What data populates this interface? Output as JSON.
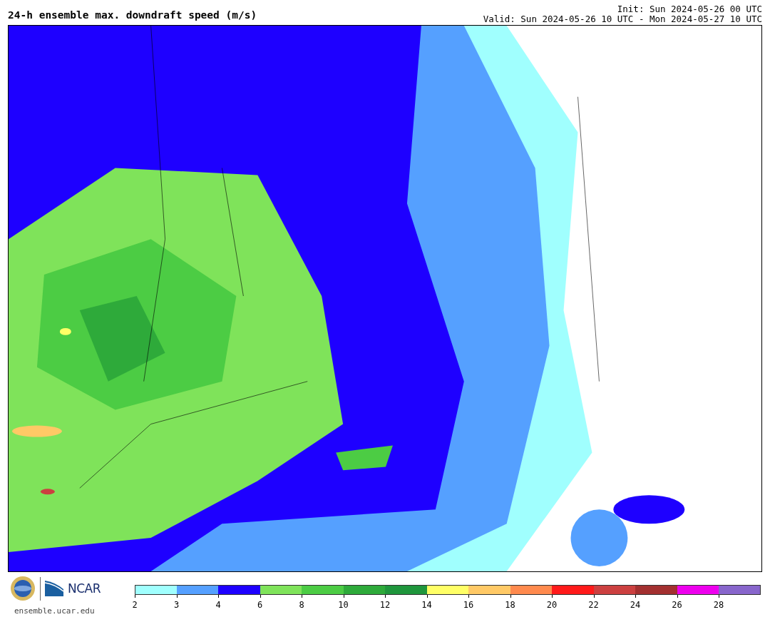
{
  "title": "24-h ensemble max. downdraft speed (m/s)",
  "init": "Init: Sun 2024-05-26 00 UTC",
  "valid": "Valid: Sun 2024-05-26 10 UTC - Mon 2024-05-27 10 UTC",
  "logo": {
    "text": "NCAR",
    "url": "ensemble.ucar.edu"
  },
  "colorbar": {
    "segments": [
      {
        "color": "#a0fffe",
        "tick": "2"
      },
      {
        "color": "#55a0ff",
        "tick": "3"
      },
      {
        "color": "#1e00ff",
        "tick": "4"
      },
      {
        "color": "#7fe35a",
        "tick": "6"
      },
      {
        "color": "#4ccc44",
        "tick": "8"
      },
      {
        "color": "#2eaa3a",
        "tick": "10"
      },
      {
        "color": "#1f963c",
        "tick": "12"
      },
      {
        "color": "#ffff66",
        "tick": "14"
      },
      {
        "color": "#ffc966",
        "tick": "16"
      },
      {
        "color": "#ff8a4e",
        "tick": "18"
      },
      {
        "color": "#ff1a1a",
        "tick": "20"
      },
      {
        "color": "#cc4040",
        "tick": "22"
      },
      {
        "color": "#a33030",
        "tick": "24"
      },
      {
        "color": "#ee00ee",
        "tick": "26"
      },
      {
        "color": "#8866cc",
        "tick": "28"
      }
    ]
  }
}
